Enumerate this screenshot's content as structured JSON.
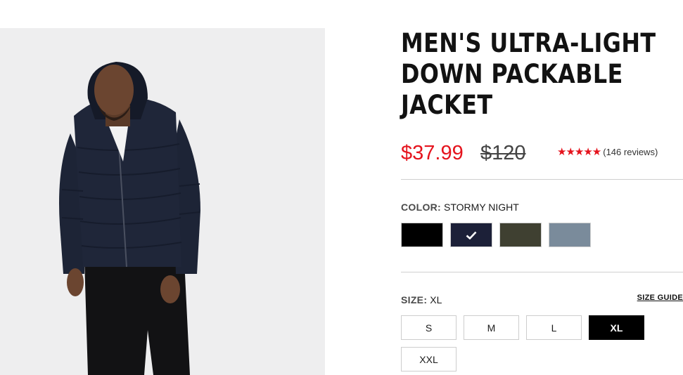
{
  "product": {
    "title_lines": [
      "MEN'S ULTRA-LIGHT",
      "DOWN PACKABLE",
      "JACKET"
    ],
    "sale_price": "$37.99",
    "original_price": "$120",
    "rating": {
      "stars": "★★★★★",
      "value": 5,
      "reviews_text": "(146 reviews)"
    }
  },
  "color": {
    "label": "COLOR:",
    "selected": "STORMY NIGHT",
    "swatches": [
      {
        "name": "black",
        "hex": "#000000",
        "selected": false
      },
      {
        "name": "stormy night",
        "hex": "#1c2038",
        "selected": true
      },
      {
        "name": "olive",
        "hex": "#3f4031",
        "selected": false
      },
      {
        "name": "slate blue",
        "hex": "#7a8b9b",
        "selected": false
      }
    ]
  },
  "size": {
    "label": "SIZE:",
    "selected": "XL",
    "guide_label": "SIZE GUIDE",
    "options": [
      "S",
      "M",
      "L",
      "XL",
      "XXL"
    ]
  },
  "colors": {
    "sale": "#e5131d",
    "selected_bg": "#000000"
  }
}
